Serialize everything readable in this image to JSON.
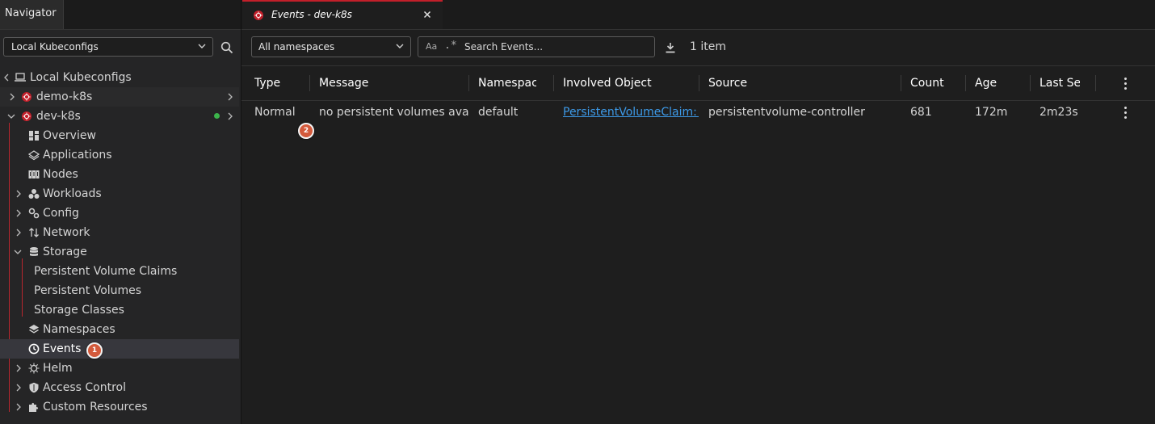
{
  "navigator": {
    "tab_label": "Navigator",
    "kubeconfig_select": "Local Kubeconfigs",
    "tree": {
      "root": "Local Kubeconfigs",
      "clusters": [
        {
          "name": "demo-k8s"
        },
        {
          "name": "dev-k8s",
          "status": "connected"
        }
      ],
      "items": {
        "overview": "Overview",
        "applications": "Applications",
        "nodes": "Nodes",
        "workloads": "Workloads",
        "config": "Config",
        "network": "Network",
        "storage": "Storage",
        "pvc": "Persistent Volume Claims",
        "pv": "Persistent Volumes",
        "storage_classes": "Storage Classes",
        "namespaces": "Namespaces",
        "events": "Events",
        "helm": "Helm",
        "access_control": "Access Control",
        "custom_resources": "Custom Resources"
      }
    },
    "badge_1": "1"
  },
  "main": {
    "tab": {
      "title": "Events - dev-k8s"
    },
    "toolbar": {
      "namespace_select": "All namespaces",
      "search_case_label": "Aa",
      "search_regex_label": ".*",
      "search_placeholder": "Search Events...",
      "item_count": "1 item"
    },
    "table": {
      "columns": [
        "Type",
        "Message",
        "Namespac",
        "Involved Object",
        "Source",
        "Count",
        "Age",
        "Last Se"
      ],
      "rows": [
        {
          "type": "Normal",
          "message": "no persistent volumes available",
          "namespace": "default",
          "involved_object": "PersistentVolumeClaim: r",
          "source": "persistentvolume-controller",
          "count": "681",
          "age": "172m",
          "last_seen": "2m23s"
        }
      ]
    },
    "badge_2": "2"
  },
  "colors": {
    "accent_red": "#c31f2a",
    "status_green": "#3cb44b",
    "link_blue": "#3d9ae8",
    "badge_orange": "#d35a3c"
  }
}
